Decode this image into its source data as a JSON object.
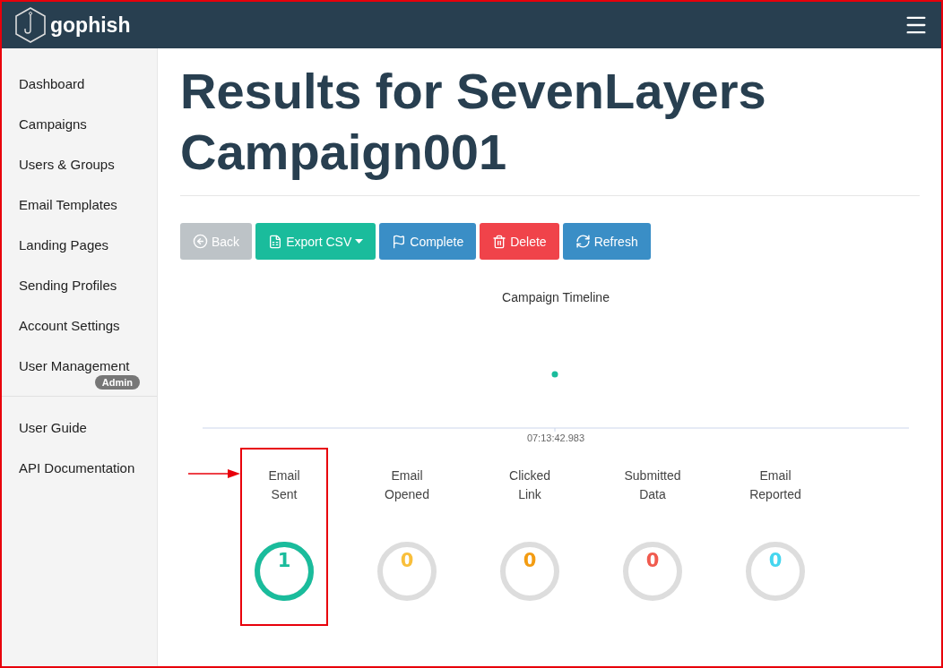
{
  "navbar": {
    "brand": "gophish"
  },
  "sidebar": {
    "items": [
      {
        "label": "Dashboard"
      },
      {
        "label": "Campaigns"
      },
      {
        "label": "Users & Groups"
      },
      {
        "label": "Email Templates"
      },
      {
        "label": "Landing Pages"
      },
      {
        "label": "Sending Profiles"
      },
      {
        "label": "Account Settings"
      },
      {
        "label": "User Management",
        "badge": "Admin"
      }
    ],
    "secondary_items": [
      {
        "label": "User Guide"
      },
      {
        "label": "API Documentation"
      }
    ]
  },
  "title": "Results for SevenLayers Campaign001",
  "buttons": [
    {
      "kind": "back",
      "label": "Back",
      "color": "#bdc3c7"
    },
    {
      "kind": "export",
      "label": "Export CSV",
      "color": "#1abc9c"
    },
    {
      "kind": "complete",
      "label": "Complete",
      "color": "#3a8ec6"
    },
    {
      "kind": "delete",
      "label": "Delete",
      "color": "#f0434a"
    },
    {
      "kind": "refresh",
      "label": "Refresh",
      "color": "#3a8ec6"
    }
  ],
  "timeline": {
    "title": "Campaign Timeline",
    "tick": "07:13:42.983"
  },
  "stats": [
    {
      "label": "Email Sent",
      "value": "1",
      "color": "#1abc9c",
      "level": 1,
      "annotated": true
    },
    {
      "label": "Email Opened",
      "value": "0",
      "color": "#f9bf3b",
      "level": 0,
      "annotated": false
    },
    {
      "label": "Clicked Link",
      "value": "0",
      "color": "#f39c12",
      "level": 0,
      "annotated": false
    },
    {
      "label": "Submitted Data",
      "value": "0",
      "color": "#f05b4f",
      "level": 0,
      "annotated": false
    },
    {
      "label": "Email Reported",
      "value": "0",
      "color": "#45d6ef",
      "level": 0,
      "annotated": false
    }
  ]
}
